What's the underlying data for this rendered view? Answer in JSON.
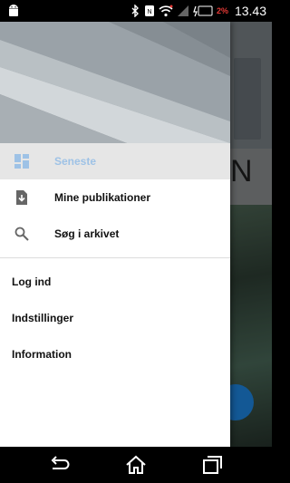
{
  "status_bar": {
    "time": "13.43",
    "battery_percent": "2%",
    "icons": [
      "android-icon",
      "bluetooth-icon",
      "nfc-icon",
      "wifi-icon",
      "signal-icon",
      "battery-icon"
    ],
    "battery_color": "#e53935"
  },
  "background_app": {
    "visible_letter": "N"
  },
  "drawer": {
    "items": [
      {
        "label": "Seneste",
        "icon": "dashboard-icon",
        "selected": true
      },
      {
        "label": "Mine publikationer",
        "icon": "download-icon",
        "selected": false
      },
      {
        "label": "Søg i arkivet",
        "icon": "search-icon",
        "selected": false
      }
    ],
    "secondary_items": [
      {
        "label": "Log ind"
      },
      {
        "label": "Indstillinger"
      },
      {
        "label": "Information"
      }
    ],
    "selected_color": "#9ec2e6"
  },
  "nav_bar": {
    "buttons": [
      "back-icon",
      "home-icon",
      "recents-icon"
    ]
  }
}
